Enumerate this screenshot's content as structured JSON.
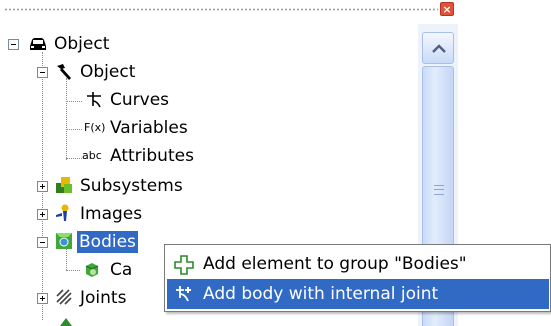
{
  "window": {
    "close_glyph": "×"
  },
  "tree": {
    "items": [
      {
        "label": "Object",
        "icon": "car-icon",
        "expander": "minus"
      },
      {
        "label": "Object",
        "icon": "hammer-icon",
        "expander": "minus"
      },
      {
        "label": "Curves",
        "icon": "curves-icon"
      },
      {
        "label": "Variables",
        "icon": "function-icon",
        "icon_text": "F(x)"
      },
      {
        "label": "Attributes",
        "icon": "abc-icon",
        "icon_text": "abc"
      },
      {
        "label": "Subsystems",
        "icon": "subsystems-icon",
        "expander": "plus"
      },
      {
        "label": "Images",
        "icon": "images-icon",
        "expander": "plus"
      },
      {
        "label": "Bodies",
        "icon": "bodies-icon",
        "expander": "minus",
        "selected": true
      },
      {
        "label": "Ca",
        "icon": "body-icon"
      },
      {
        "label": "Joints",
        "icon": "joints-icon",
        "expander": "plus"
      }
    ]
  },
  "context_menu": {
    "items": [
      {
        "label": "Add element to group \"Bodies\"",
        "icon": "add-element-icon"
      },
      {
        "label": "Add body with internal joint",
        "icon": "add-body-joint-icon",
        "highlighted": true
      }
    ]
  },
  "colors": {
    "selection": "#316ac5",
    "scrollbar_track": "#eef3fb",
    "close_button": "#e0523a"
  }
}
